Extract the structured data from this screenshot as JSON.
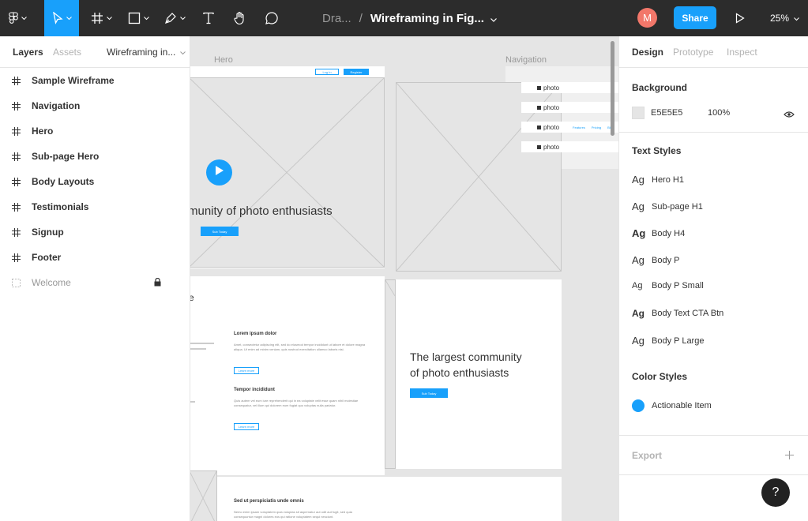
{
  "topbar": {
    "project": "Dra...",
    "separator": "/",
    "file_name": "Wireframing in Fig...",
    "avatar_initial": "M",
    "share_label": "Share",
    "zoom": "25%",
    "colors": {
      "bar": "#2c2c2c",
      "accent": "#18a0fb",
      "avatar": "#f2776a"
    },
    "icons": [
      "figma-menu-icon",
      "move-tool-icon",
      "frame-tool-icon",
      "shape-tool-icon",
      "pen-tool-icon",
      "text-tool-icon",
      "hand-tool-icon",
      "comment-tool-icon",
      "present-icon"
    ]
  },
  "layers_panel": {
    "tab_layers": "Layers",
    "tab_assets": "Assets",
    "page_name": "Wireframing in...",
    "layers": [
      {
        "label": "Sample Wireframe",
        "icon": "frame-icon"
      },
      {
        "label": "Navigation",
        "icon": "frame-icon"
      },
      {
        "label": "Hero",
        "icon": "frame-icon"
      },
      {
        "label": "Sub-page Hero",
        "icon": "frame-icon"
      },
      {
        "label": "Body Layouts",
        "icon": "frame-icon"
      },
      {
        "label": "Testimonials",
        "icon": "frame-icon"
      },
      {
        "label": "Signup",
        "icon": "frame-icon"
      },
      {
        "label": "Footer",
        "icon": "frame-icon"
      },
      {
        "label": "Welcome",
        "icon": "dashed-frame-icon",
        "locked": true
      }
    ]
  },
  "canvas": {
    "frame_labels": {
      "hero": "Hero",
      "navigation": "Navigation"
    },
    "hero_nav": {
      "login": "Log In",
      "register": "Register"
    },
    "hero_text": "munity of photo enthusiasts",
    "hero_button": "Sub Today",
    "nav_items": [
      "photo",
      "photo",
      "photo",
      "photo"
    ],
    "nav_links": [
      "Features",
      "Pricing",
      "Blog"
    ],
    "body_partial_heading": "e",
    "body_items": [
      {
        "heading": "Lorem ipsum dolor",
        "text": "Amet, consectetur adipiscing elit, sed do eiusmod tempor incididunt ut labore et dolore magna aliqua. Ut enim ad minim veniam, quis nostrud exercitation ullamco laboris nisi.",
        "button": "Learn more"
      },
      {
        "heading": "Tempor incididunt",
        "text": "Quis autem vel eum iure reprehenderit qui in ea voluptate velit esse quam nihil molestiae consequatur, vel illum qui dolorem eum fugiat quo voluptas nulla pariatur.",
        "button": "Learn more"
      }
    ],
    "subpage_hero_text_line1": "The largest community",
    "subpage_hero_text_line2": "of photo enthusiasts",
    "subpage_hero_button": "Sub Today",
    "bottom_heading": "Sed ut perspiciatis unde omnis",
    "bottom_text": "Nemo enim ipsam voluptatem quia voluptas sit aspernatur aut odit aut fugit, sed quia consequuntur magni dolores eos qui ratione voluptatem sequi nesciunt.",
    "colors": {
      "canvas": "#e5e5e5",
      "placeholder": "#e5e5e5",
      "button": "#18a0fb"
    }
  },
  "design_panel": {
    "tab_design": "Design",
    "tab_prototype": "Prototype",
    "tab_inspect": "Inspect",
    "background_title": "Background",
    "background_hex": "E5E5E5",
    "background_opacity": "100%",
    "background_swatch": "#e5e5e5",
    "text_styles_title": "Text Styles",
    "text_styles": [
      {
        "label": "Hero H1",
        "bold": false
      },
      {
        "label": "Sub-page H1",
        "bold": false
      },
      {
        "label": "Body H4",
        "bold": true
      },
      {
        "label": "Body P",
        "bold": false
      },
      {
        "label": "Body P Small",
        "bold": false
      },
      {
        "label": "Body Text CTA Btn",
        "bold": true
      },
      {
        "label": "Body P Large",
        "bold": false
      }
    ],
    "ag_glyph": "Ag",
    "color_styles_title": "Color Styles",
    "color_styles": [
      {
        "label": "Actionable Item",
        "color": "#18a0fb"
      }
    ],
    "export_title": "Export",
    "help": "?"
  }
}
